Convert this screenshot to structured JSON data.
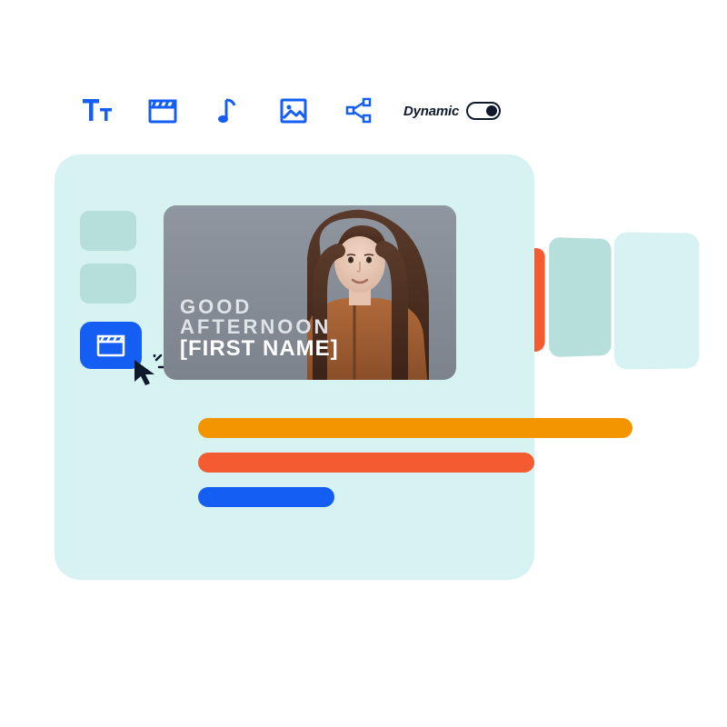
{
  "colors": {
    "blue": "#155ef4",
    "orange_dark": "#f45b31",
    "orange": "#f29500",
    "panel": "#d6f3f1",
    "panel_muted": "#b6dedb",
    "ink": "#0e1a2b"
  },
  "toolbar": {
    "text_tool": "text-tool",
    "scene_tool": "scene-tool",
    "music_tool": "music-tool",
    "image_tool": "image-tool",
    "share_tool": "share-tool",
    "dynamic_label": "Dynamic",
    "dynamic_on": true
  },
  "sidebar": {
    "thumbs": [
      {
        "active": false
      },
      {
        "active": false
      },
      {
        "active": true
      }
    ]
  },
  "preview": {
    "greeting_line1": "GOOD",
    "greeting_line2": "AFTERNOON",
    "placeholder": "[FIRST NAME]"
  },
  "timeline": {
    "tracks": [
      {
        "color": "orange",
        "length": "long"
      },
      {
        "color": "orange_dark",
        "length": "medium"
      },
      {
        "color": "blue",
        "length": "short"
      }
    ]
  }
}
